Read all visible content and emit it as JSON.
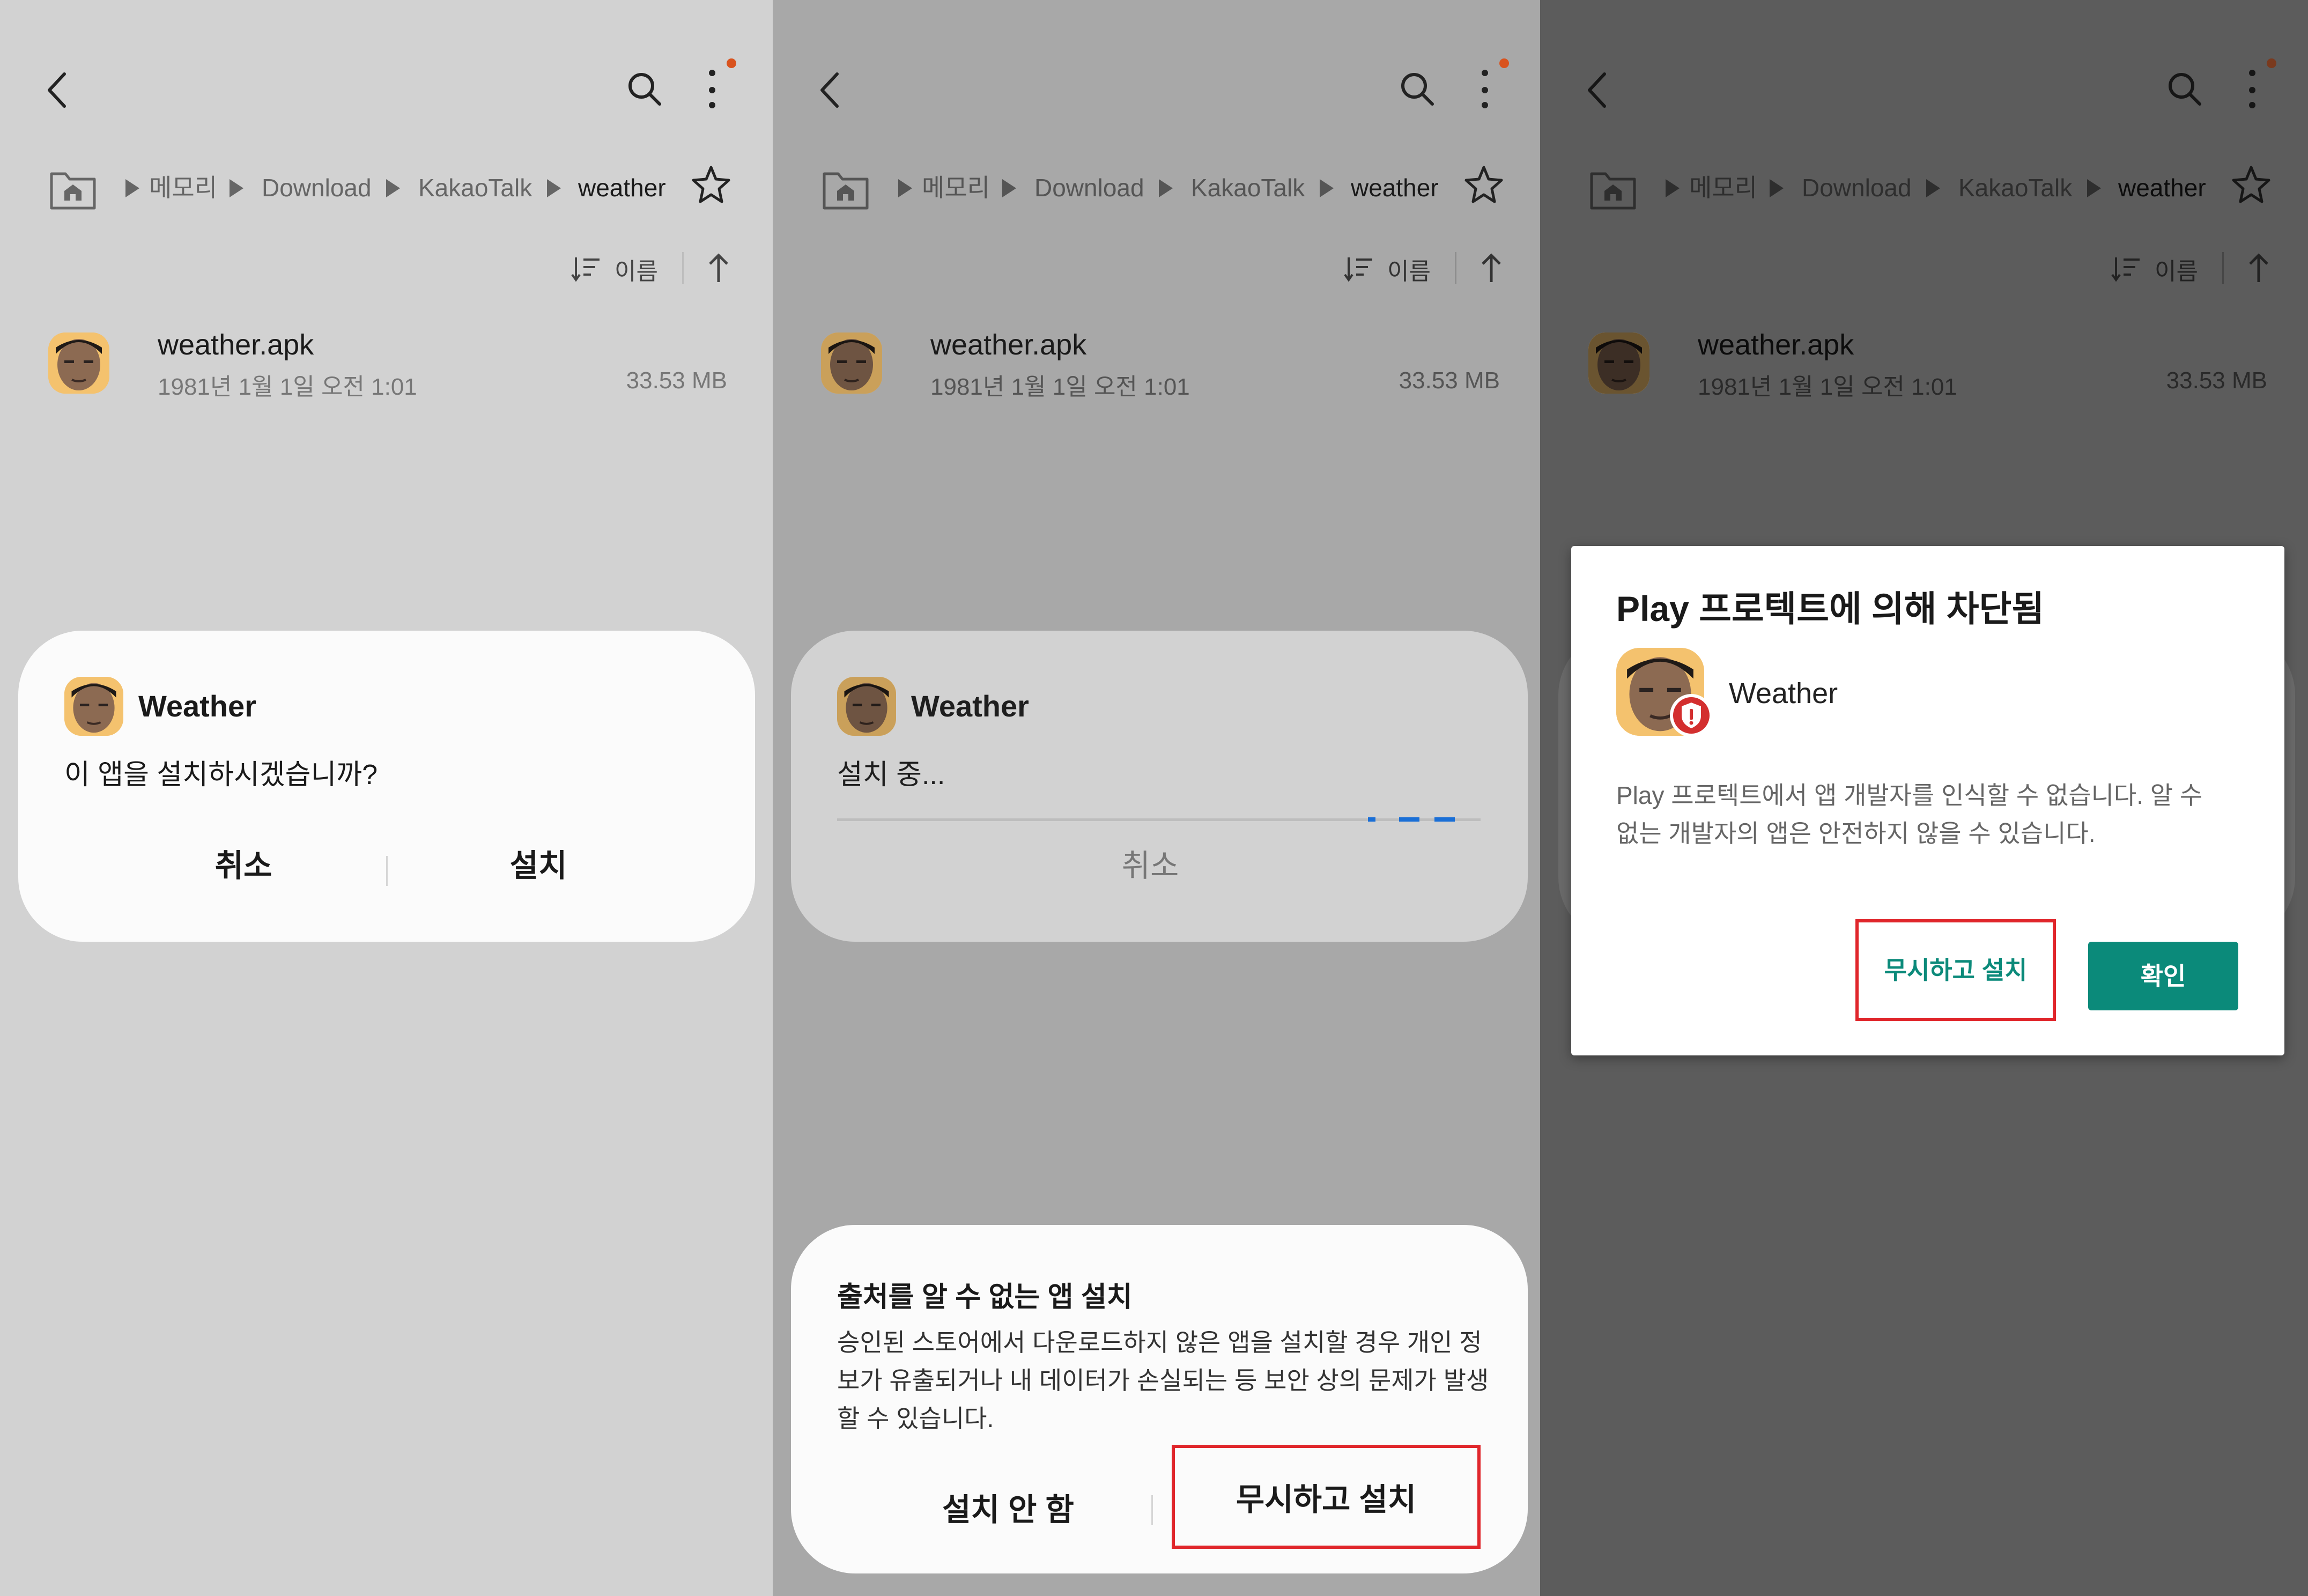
{
  "breadcrumb": [
    "메모리",
    "Download",
    "KakaoTalk",
    "weather"
  ],
  "sort_label": "이름",
  "file": {
    "name": "weather.apk",
    "date": "1981년 1월 1일 오전 1:01",
    "size": "33.53 MB"
  },
  "install_dialog": {
    "app_name": "Weather",
    "question": "이 앱을 설치하시겠습니까?",
    "cancel": "취소",
    "install": "설치"
  },
  "installing_dialog": {
    "app_name": "Weather",
    "status": "설치 중...",
    "cancel": "취소"
  },
  "unknown_source_sheet": {
    "title": "출처를 알 수 없는 앱 설치",
    "body": "승인된 스토어에서 다운로드하지 않은 앱을 설치할 경우 개인 정보가 유출되거나 내 데이터가 손실되는 등 보안 상의 문제가 발생할 수 있습니다.",
    "dont_install": "설치 안 함",
    "ignore_install": "무시하고 설치"
  },
  "protect_dialog": {
    "title": "Play 프로텍트에 의해 차단됨",
    "app_name": "Weather",
    "body": "Play 프로텍트에서 앱 개발자를 인식할 수 없습니다. 알 수 없는 개발자의 앱은 안전하지 않을 수 있습니다.",
    "ignore_install": "무시하고 설치",
    "ok": "확인"
  },
  "icons": [
    "back-arrow-icon",
    "search-icon",
    "more-options-icon",
    "home-folder-icon",
    "star-icon",
    "sort-icon",
    "sort-direction-icon",
    "app-avatar",
    "shield-alert-icon"
  ],
  "colors": {
    "accent_teal": "#0b8a7a",
    "highlight_red": "#e0262b",
    "notification_dot": "#d9531e",
    "progress_blue": "#1a6fd6"
  }
}
